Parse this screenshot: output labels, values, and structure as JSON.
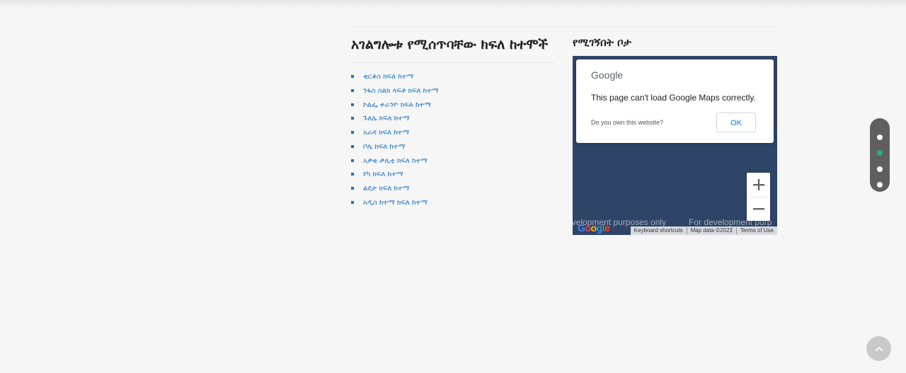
{
  "services": {
    "title": "አገልግሎቱ የሚሰጥባቸው ክፍለ ከተሞች",
    "districts": [
      "ቂርቆስ ክፍለ ከተማ",
      "ንፋስ ስልክ ላፍቶ ክፍለ ከተማ",
      "ኮልፌ ቀራንዮ ክፍለ ከተማ",
      "ጉለሌ ክፍለ ከተማ",
      "አራዳ ክፍለ ከተማ",
      "ቦሌ ክፍለ ከተማ",
      "አቃቂ ቃሊቲ ክፍለ ከተማ",
      "የካ ክፍለ ከተማ",
      "ልደታ ክፍለ ከተማ",
      "አዲስ ከተማ ክፍለ ከተማ"
    ]
  },
  "location": {
    "title": "የሚገኝበት ቦታ",
    "map": {
      "dialog_logo": "Google",
      "error_message": "This page can't load Google Maps correctly.",
      "own_site_link": "Do you own this website?",
      "ok_label": "OK",
      "watermark_left": "evelopment purposes only",
      "watermark_right": "For development purp",
      "footer": {
        "shortcuts": "Keyboard shortcuts",
        "map_data": "Map data ©2023",
        "terms": "Terms of Use"
      },
      "logo_text": "Google",
      "background_color": "#2f4568"
    }
  },
  "dot_nav": {
    "active_index": 1,
    "active_color": "#2ab27b",
    "count": 4
  },
  "colors": {
    "link": "#1e73be",
    "page_bg": "#f6f6f6"
  }
}
